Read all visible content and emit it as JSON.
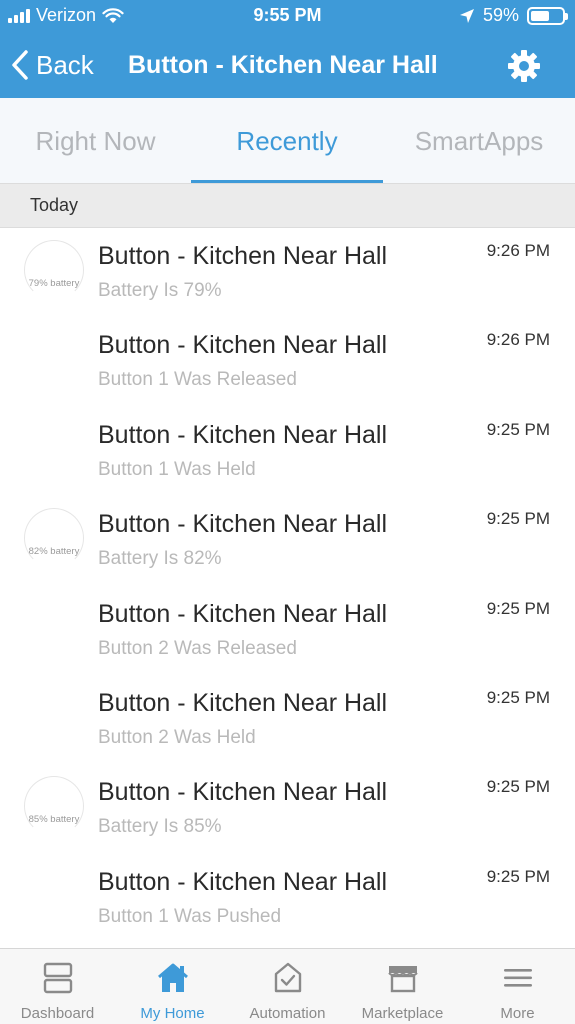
{
  "status_bar": {
    "carrier": "Verizon",
    "time": "9:55 PM",
    "battery_percent": "59%",
    "battery_level": 0.59,
    "icons": [
      "signal-icon",
      "wifi-icon",
      "location-arrow-icon",
      "battery-icon"
    ]
  },
  "nav": {
    "back_label": "Back",
    "title": "Button - Kitchen Near Hall",
    "settings_icon": "gear-icon"
  },
  "tabs": [
    {
      "label": "Right Now",
      "active": false
    },
    {
      "label": "Recently",
      "active": true
    },
    {
      "label": "SmartApps",
      "active": false
    }
  ],
  "section": {
    "label": "Today"
  },
  "events": [
    {
      "title": "Button - Kitchen Near Hall",
      "subtitle": "Battery Is 79%",
      "time": "9:26 PM",
      "battery_label": "79% battery"
    },
    {
      "title": "Button - Kitchen Near Hall",
      "subtitle": "Button 1 Was Released",
      "time": "9:26 PM",
      "battery_label": ""
    },
    {
      "title": "Button - Kitchen Near Hall",
      "subtitle": "Button 1 Was Held",
      "time": "9:25 PM",
      "battery_label": ""
    },
    {
      "title": "Button - Kitchen Near Hall",
      "subtitle": "Battery Is 82%",
      "time": "9:25 PM",
      "battery_label": "82% battery"
    },
    {
      "title": "Button - Kitchen Near Hall",
      "subtitle": "Button 2 Was Released",
      "time": "9:25 PM",
      "battery_label": ""
    },
    {
      "title": "Button - Kitchen Near Hall",
      "subtitle": "Button 2 Was Held",
      "time": "9:25 PM",
      "battery_label": ""
    },
    {
      "title": "Button - Kitchen Near Hall",
      "subtitle": "Battery Is 85%",
      "time": "9:25 PM",
      "battery_label": "85% battery"
    },
    {
      "title": "Button - Kitchen Near Hall",
      "subtitle": "Button 1 Was Pushed",
      "time": "9:25 PM",
      "battery_label": ""
    }
  ],
  "tabbar": [
    {
      "label": "Dashboard",
      "icon": "dashboard-icon",
      "active": false
    },
    {
      "label": "My Home",
      "icon": "home-icon",
      "active": true
    },
    {
      "label": "Automation",
      "icon": "automation-icon",
      "active": false
    },
    {
      "label": "Marketplace",
      "icon": "marketplace-icon",
      "active": false
    },
    {
      "label": "More",
      "icon": "menu-icon",
      "active": false
    }
  ],
  "colors": {
    "accent": "#3e9ad8",
    "inactive": "#8a8a8a",
    "muted_text": "#b9b9b9"
  }
}
